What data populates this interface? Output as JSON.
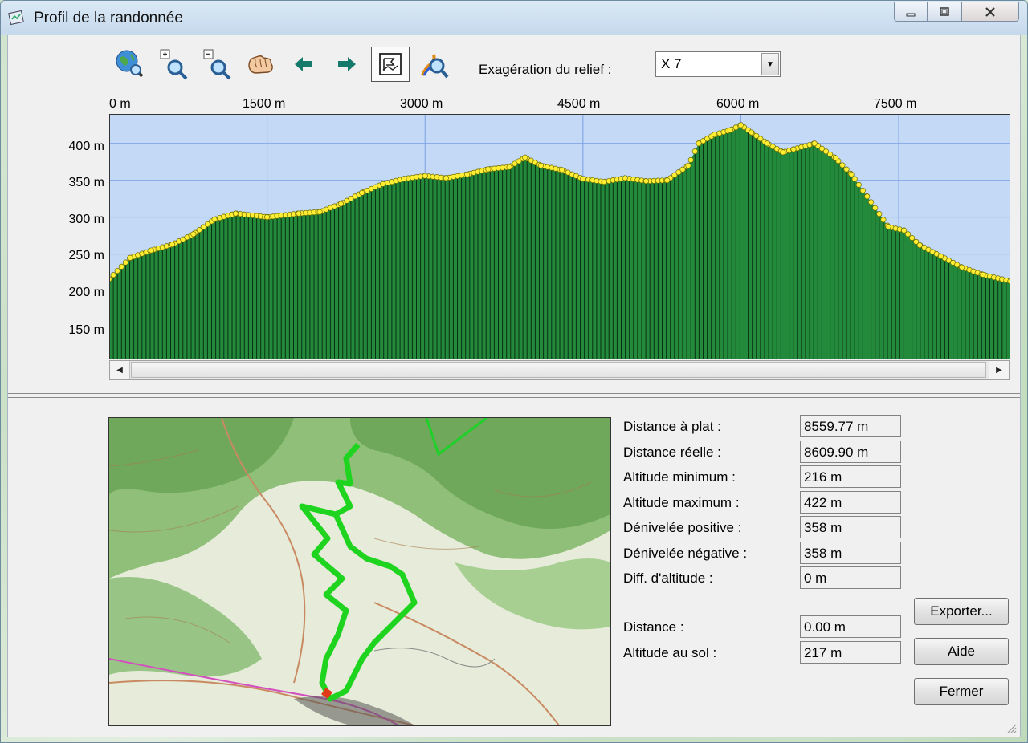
{
  "window": {
    "title": "Profil de la randonnée"
  },
  "toolbar": {
    "tools": [
      "zoom-globe-icon",
      "zoom-in-icon",
      "zoom-out-icon",
      "pan-hand-icon",
      "arrow-left-icon",
      "arrow-right-icon",
      "flag-profile-icon",
      "route-zoom-icon"
    ],
    "relief_label": "Exagération du relief :",
    "relief_value": "X 7"
  },
  "profile": {
    "x_ticks": [
      "0 m",
      "1500 m",
      "3000 m",
      "4500 m",
      "6000 m",
      "7500 m"
    ],
    "y_ticks": [
      "400 m",
      "350 m",
      "300 m",
      "250 m",
      "200 m",
      "150 m"
    ]
  },
  "chart_data": {
    "type": "area",
    "xlabel": "",
    "ylabel": "",
    "xlim": [
      0,
      8560
    ],
    "ylim": [
      107,
      440
    ],
    "grid": true,
    "x": [
      0,
      200,
      400,
      600,
      800,
      1000,
      1200,
      1500,
      1800,
      2000,
      2200,
      2400,
      2600,
      2800,
      3000,
      3200,
      3400,
      3600,
      3800,
      3950,
      4100,
      4300,
      4500,
      4700,
      4900,
      5100,
      5300,
      5500,
      5600,
      5750,
      5900,
      6000,
      6100,
      6250,
      6400,
      6500,
      6700,
      6900,
      7050,
      7200,
      7400,
      7550,
      7700,
      7900,
      8100,
      8300,
      8559
    ],
    "series": [
      {
        "values": [
          216,
          245,
          255,
          263,
          277,
          297,
          305,
          300,
          305,
          307,
          318,
          333,
          345,
          352,
          356,
          353,
          358,
          365,
          368,
          381,
          370,
          364,
          352,
          348,
          353,
          349,
          350,
          370,
          400,
          412,
          418,
          425,
          415,
          400,
          388,
          392,
          400,
          380,
          358,
          328,
          287,
          282,
          262,
          247,
          232,
          222,
          213
        ]
      }
    ],
    "colors": {
      "fill": "#238a3c",
      "point": "#ffee33",
      "background": "#c3d9f6",
      "grid": "#7b9fe3"
    }
  },
  "stats": [
    {
      "label": "Distance à plat :",
      "value": "8559.77 m"
    },
    {
      "label": "Distance réelle :",
      "value": "8609.90 m"
    },
    {
      "label": "Altitude minimum :",
      "value": "216 m"
    },
    {
      "label": "Altitude maximum :",
      "value": "422 m"
    },
    {
      "label": "Dénivelée positive :",
      "value": "358 m"
    },
    {
      "label": "Dénivelée négative :",
      "value": "358 m"
    },
    {
      "label": "Diff. d'altitude :",
      "value": "0 m"
    }
  ],
  "cursor": {
    "distance_label": "Distance :",
    "distance_value": "0.00 m",
    "altitude_label": "Altitude au sol :",
    "altitude_value": "217 m"
  },
  "buttons": {
    "export": "Exporter...",
    "help": "Aide",
    "close": "Fermer"
  }
}
